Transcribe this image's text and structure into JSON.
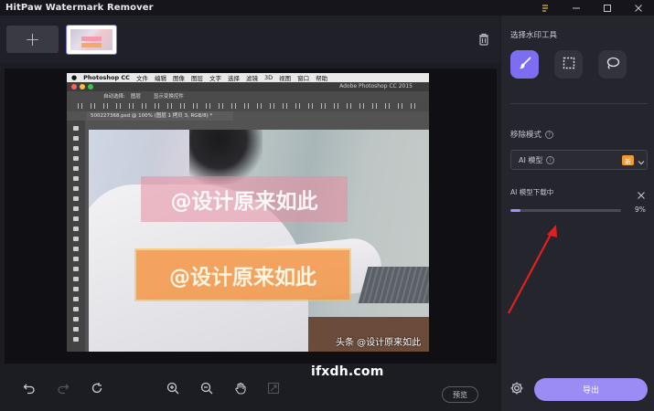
{
  "app": {
    "title": "HitPaw Watermark Remover"
  },
  "window_controls": [
    "pin-icon",
    "minimize-icon",
    "maximize-icon",
    "close-icon"
  ],
  "thumbbar": {
    "add_label": "+"
  },
  "photoshop": {
    "menu": [
      "Photoshop CC",
      "文件",
      "编辑",
      "图像",
      "图层",
      "文字",
      "选择",
      "滤镜",
      "3D",
      "视图",
      "窗口",
      "帮助"
    ],
    "window_title": "Adobe Photoshop CC 2015",
    "options": [
      "自动选择:",
      "图层",
      "显示变换控件"
    ],
    "doc_tab": "500227368.psd @ 100% (图层 1 拷贝 3, RGB/8) *",
    "watermark_1": "@设计原来如此",
    "watermark_2": "@设计原来如此",
    "corner_text": "头条 @设计原来如此"
  },
  "bottom_toolbar": {
    "icons": [
      "undo-icon",
      "redo-icon",
      "reset-icon",
      "zoom-in-icon",
      "zoom-out-icon",
      "hand-icon",
      "fit-icon"
    ],
    "preview_label": "预览"
  },
  "overlay_watermark": "ifxdh.com",
  "right_panel": {
    "tool_title": "选择水印工具",
    "tools": [
      "brush-icon",
      "rect-select-icon",
      "lasso-icon"
    ],
    "mode_title": "移除模式",
    "mode_select": {
      "value": "AI 模型",
      "badge": "新"
    },
    "download": {
      "label": "AI 模型下载中",
      "percent_text": "9%",
      "progress": 0.09
    },
    "export_label": "导出"
  },
  "colors": {
    "accent": "#7d6df0",
    "export": "#9b8cf5",
    "badge": "#f29a2e",
    "annotation_arrow": "#e02020"
  }
}
